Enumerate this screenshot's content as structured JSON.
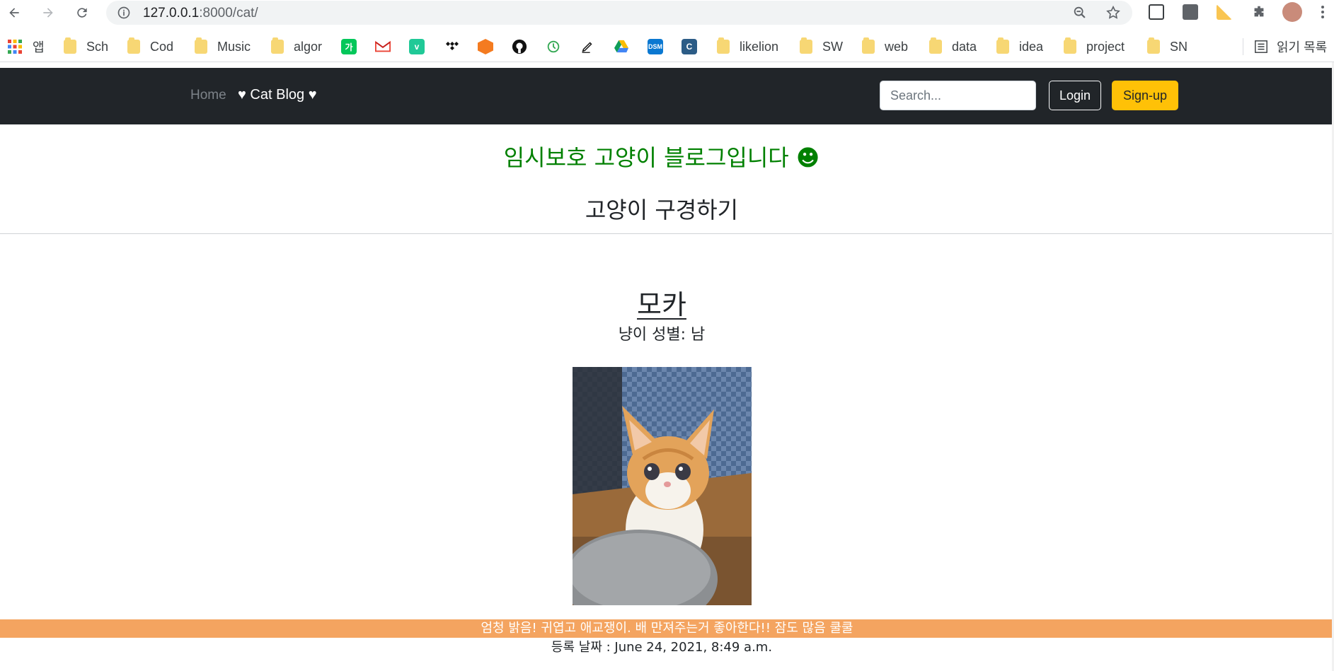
{
  "browser": {
    "url_host": "127.0.0.1",
    "url_path": ":8000/cat/",
    "icons": [
      "back-icon",
      "forward-icon",
      "reload-icon",
      "site-info-icon",
      "zoom-icon",
      "star-icon",
      "extensions-icon",
      "menu-icon"
    ]
  },
  "bookmarks": {
    "apps_label": "앱",
    "folders": [
      "Sch",
      "Cod",
      "Music",
      "algor",
      "likelion",
      "SW",
      "web",
      "data",
      "idea",
      "project",
      "SN"
    ],
    "reading_list": "읽기 목록"
  },
  "navbar": {
    "home": "Home",
    "brand": "♥ Cat Blog ♥",
    "search_placeholder": "Search...",
    "login": "Login",
    "signup": "Sign-up",
    "colors": {
      "background": "#212529",
      "signup": "#ffc107"
    }
  },
  "page": {
    "title": "임시보호 고양이 블로그입니다 ☻",
    "section_title": "고양이 구경하기",
    "title_color": "#008000"
  },
  "post": {
    "name": "모카",
    "gender": "냥이 성별: 남",
    "description": "엄청 밝음! 귀엽고 애교쟁이. 배 만져주는거 좋아한다!! 잠도 많음 쿨쿨",
    "registered": "등록 날짜 : June 24, 2021, 8:49 a.m.",
    "description_color": "#f4a460"
  }
}
